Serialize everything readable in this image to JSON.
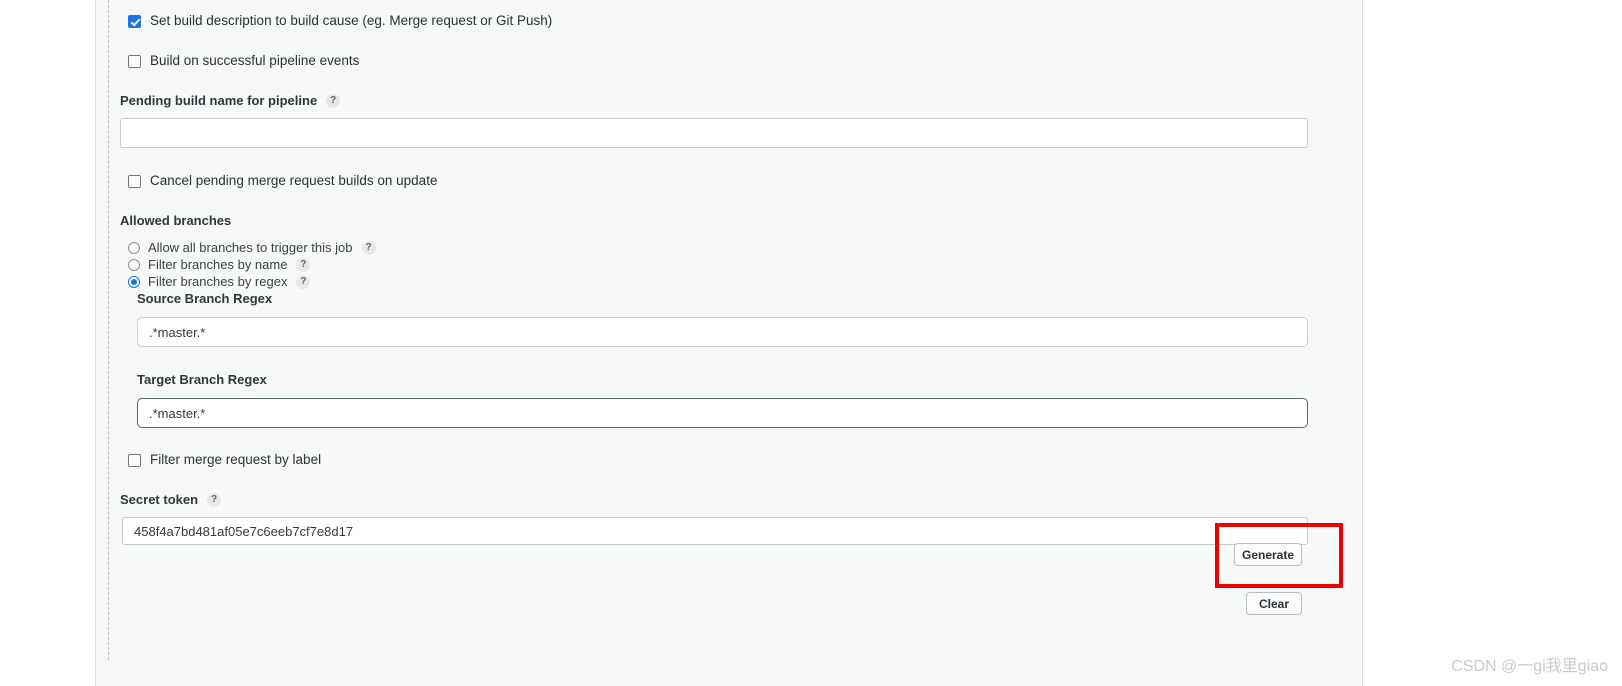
{
  "colors": {
    "panel_background": "#f7f8f8",
    "page_background": "#ffffff",
    "accent_checkbox": "#1a73e8",
    "accent_radio": "#1b73e8",
    "annotation_box": "#ec0000",
    "input_border": "#c8d0d6",
    "input_border_focused": "#55666f",
    "text": "#2b3138",
    "help_bubble": "#e6e7e8",
    "watermark": "#c9cbcc"
  },
  "form": {
    "checkboxes": {
      "set_build_description": {
        "label": "Set build description to build cause (eg. Merge request or Git Push)",
        "checked": true
      },
      "build_on_successful_pipeline": {
        "label": "Build on successful pipeline events",
        "checked": false
      },
      "cancel_pending_merge_request": {
        "label": "Cancel pending merge request builds on update",
        "checked": false
      },
      "filter_merge_request_by_label": {
        "label": "Filter merge request by label",
        "checked": false
      }
    },
    "pending_build_name": {
      "label": "Pending build name for pipeline",
      "help": "?",
      "value": "",
      "placeholder": ""
    },
    "allowed_branches": {
      "heading": "Allowed branches",
      "options": [
        {
          "label": "Allow all branches to trigger this job",
          "help": "?",
          "selected": false
        },
        {
          "label": "Filter branches by name",
          "help": "?",
          "selected": false
        },
        {
          "label": "Filter branches by regex",
          "help": "?",
          "selected": true
        }
      ]
    },
    "source_branch_regex": {
      "label": "Source Branch Regex",
      "value": ".*master.*",
      "focused": false
    },
    "target_branch_regex": {
      "label": "Target Branch Regex",
      "value": ".*master.*",
      "focused": true
    },
    "secret_token": {
      "label": "Secret token",
      "help": "?",
      "value": "458f4a7bd481af05e7c6eeb7cf7e8d17"
    },
    "buttons": {
      "generate": "Generate",
      "clear": "Clear"
    }
  },
  "watermark": {
    "text": "CSDN @一gi我里giao"
  }
}
